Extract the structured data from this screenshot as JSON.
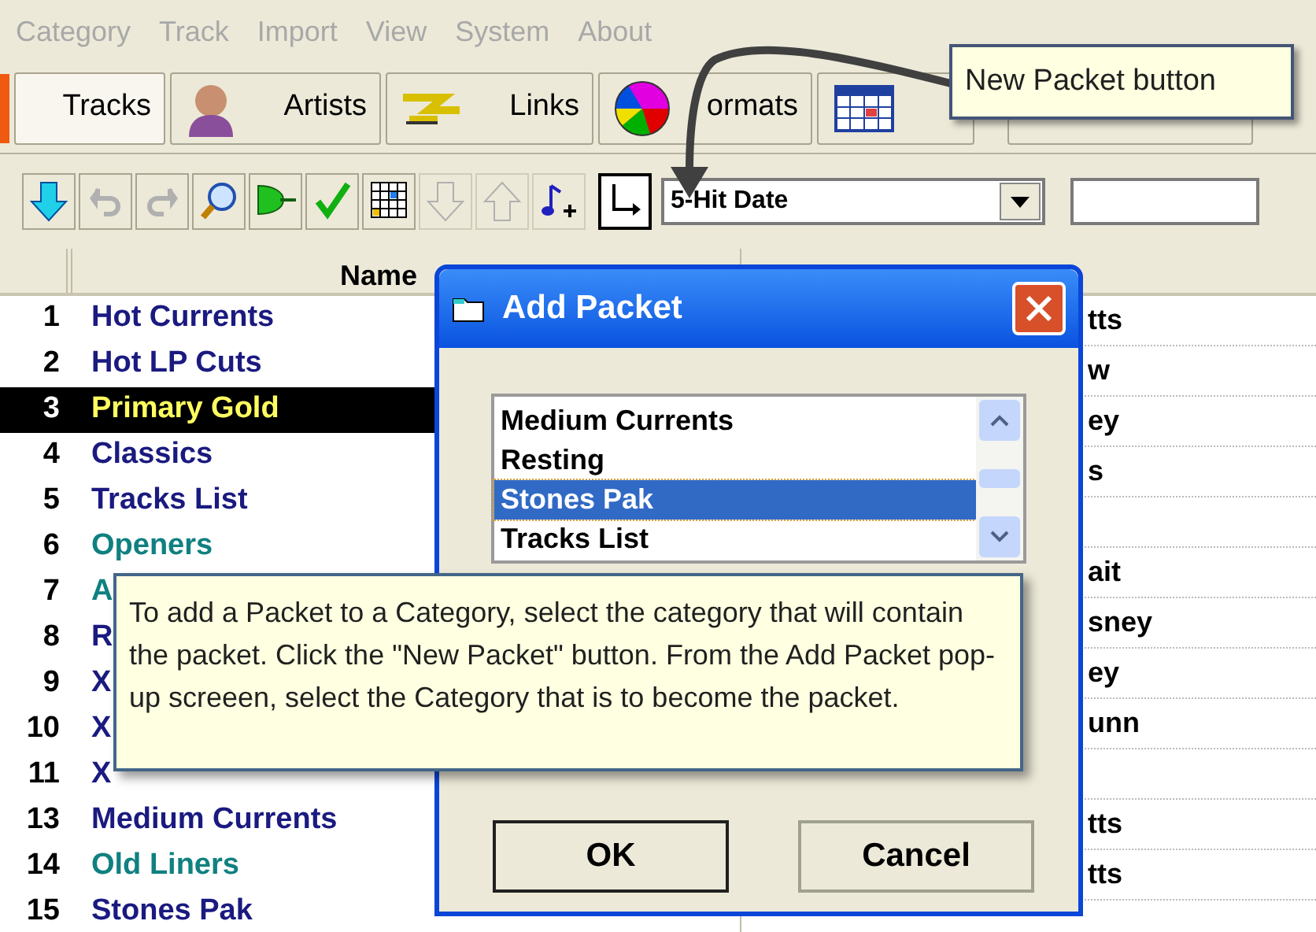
{
  "menu": [
    "Category",
    "Track",
    "Import",
    "View",
    "System",
    "About"
  ],
  "tabs": [
    {
      "label": "Tracks",
      "selected": true,
      "kind": "tracks"
    },
    {
      "label": "Artists",
      "selected": false,
      "kind": "artists"
    },
    {
      "label": "Links",
      "selected": false,
      "kind": "links"
    },
    {
      "label": "ormats",
      "selected": false,
      "kind": "formats"
    }
  ],
  "toolbar": {
    "sort_field": {
      "value": "5-Hit Date"
    }
  },
  "category_list": {
    "header": "Name",
    "rows": [
      {
        "number": "1",
        "name": "Hot Currents",
        "color": "#1a1a80",
        "selected": false
      },
      {
        "number": "2",
        "name": "Hot LP Cuts",
        "color": "#1a1a80",
        "selected": false
      },
      {
        "number": "3",
        "name": "Primary Gold",
        "selected": true
      },
      {
        "number": "4",
        "name": "Classics",
        "color": "#1a1a80",
        "selected": false
      },
      {
        "number": "5",
        "name": "Tracks List",
        "color": "#1a1a80",
        "selected": false
      },
      {
        "number": "6",
        "name": "Openers",
        "color": "#108080",
        "selected": false
      },
      {
        "number": "7",
        "name": "A",
        "color": "#108080",
        "selected": false
      },
      {
        "number": "8",
        "name": "R",
        "color": "#1a1a80",
        "selected": false
      },
      {
        "number": "9",
        "name": "X",
        "color": "#1a1a80",
        "selected": false
      },
      {
        "number": "10",
        "name": "X",
        "color": "#1a1a80",
        "selected": false
      },
      {
        "number": "11",
        "name": "X",
        "color": "#1a1a80",
        "selected": false
      },
      {
        "number": "13",
        "name": "Medium Currents",
        "color": "#1a1a80",
        "selected": false
      },
      {
        "number": "14",
        "name": "Old Liners",
        "color": "#108080",
        "selected": false
      },
      {
        "number": "15",
        "name": "Stones Pak",
        "color": "#1a1a80",
        "selected": false
      }
    ]
  },
  "right_list": {
    "rows": [
      {
        "text": "tts"
      },
      {
        "text": "w"
      },
      {
        "text": "ey"
      },
      {
        "text": "s"
      },
      {},
      {
        "text": "ait"
      },
      {
        "text": "sney"
      },
      {
        "text": "ey"
      },
      {
        "text": "unn"
      },
      {},
      {
        "text": "tts"
      },
      {
        "text": "tts"
      }
    ]
  },
  "dialog": {
    "title": "Add Packet",
    "items": [
      {
        "label": "Medium Currents",
        "selected": false
      },
      {
        "label": "Resting",
        "selected": false
      },
      {
        "label": "Stones Pak",
        "selected": true
      },
      {
        "label": "Tracks List",
        "selected": false
      }
    ],
    "buttons": [
      "OK",
      "Cancel"
    ]
  },
  "tooltip": {
    "text": "To add a Packet to a Category, select the category that will contain the packet.  Click the \"New Packet\" button.  From the Add Packet pop-up screeen, select the Category that is to become the packet."
  },
  "callout": {
    "text": "New Packet button"
  }
}
